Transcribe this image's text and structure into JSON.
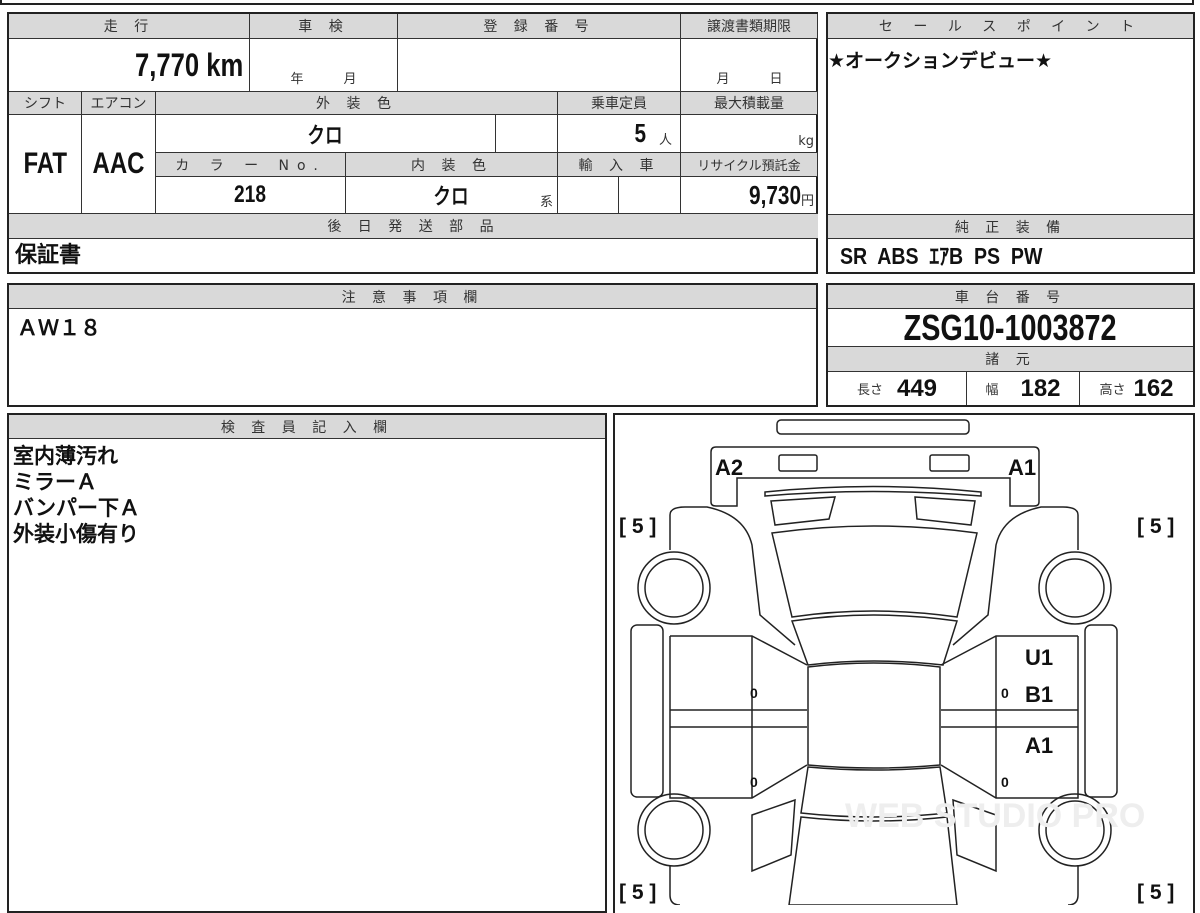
{
  "vehicle": {
    "mileage_label": "走 行",
    "mileage": "7,770 km",
    "inspection_label": "車 検",
    "inspection_year": "年",
    "inspection_month": "月",
    "registration_label": "登 録 番 号",
    "transfer_label": "譲渡書類期限",
    "transfer_month": "月",
    "transfer_day": "日",
    "shift_label": "シフト",
    "shift": "FAT",
    "ac_label": "エアコン",
    "ac": "AAC",
    "exterior_color_label": "外 装 色",
    "exterior_color": "クロ",
    "capacity_label": "乗車定員",
    "capacity": "5",
    "capacity_unit": "人",
    "max_load_label": "最大積載量",
    "max_load_unit": "kg",
    "color_no_label": "カ ラ ー No.",
    "color_no": "218",
    "interior_color_label": "内 装 色",
    "interior_color": "クロ",
    "interior_suffix": "系",
    "import_label": "輸 入 車",
    "recycle_label": "リサイクル預託金",
    "recycle_fee": "9,730",
    "recycle_unit": "円",
    "later_parts_label": "後 日 発 送 部 品",
    "later_parts": "保証書"
  },
  "sales_point": {
    "label": "セ ー ル ス ポ イ ン ト",
    "text": "★オークションデビュー★"
  },
  "equipment": {
    "label": "純 正 装 備",
    "text": "SR  ABS  ｴｱB  PS  PW"
  },
  "notes": {
    "label": "注 意 事 項 欄",
    "text": "ＡＷ１８"
  },
  "chassis": {
    "label": "車 台 番 号",
    "number": "ZSG10-1003872",
    "specs_label": "諸 元",
    "length_label": "長さ",
    "length": "449",
    "width_label": "幅",
    "width": "182",
    "height_label": "高さ",
    "height": "162"
  },
  "inspector": {
    "label": "検 査 員 記 入 欄",
    "lines": [
      "室内薄汚れ",
      "ミラーＡ",
      "バンパー下Ａ",
      "外装小傷有り"
    ]
  },
  "diagram": {
    "tire_fl": "[ 5 ]",
    "tire_fr": "[ 5 ]",
    "tire_rl": "[ 5 ]",
    "tire_rr": "[ 5 ]",
    "front_left": "A2",
    "front_right": "A1",
    "right_front_door": "U1",
    "right_front_door2": "B1",
    "right_rear_door": "A1",
    "zero1": "0",
    "zero2": "0",
    "zero3": "0",
    "zero4": "0",
    "watermark": "WEB STUDIO PRO"
  }
}
